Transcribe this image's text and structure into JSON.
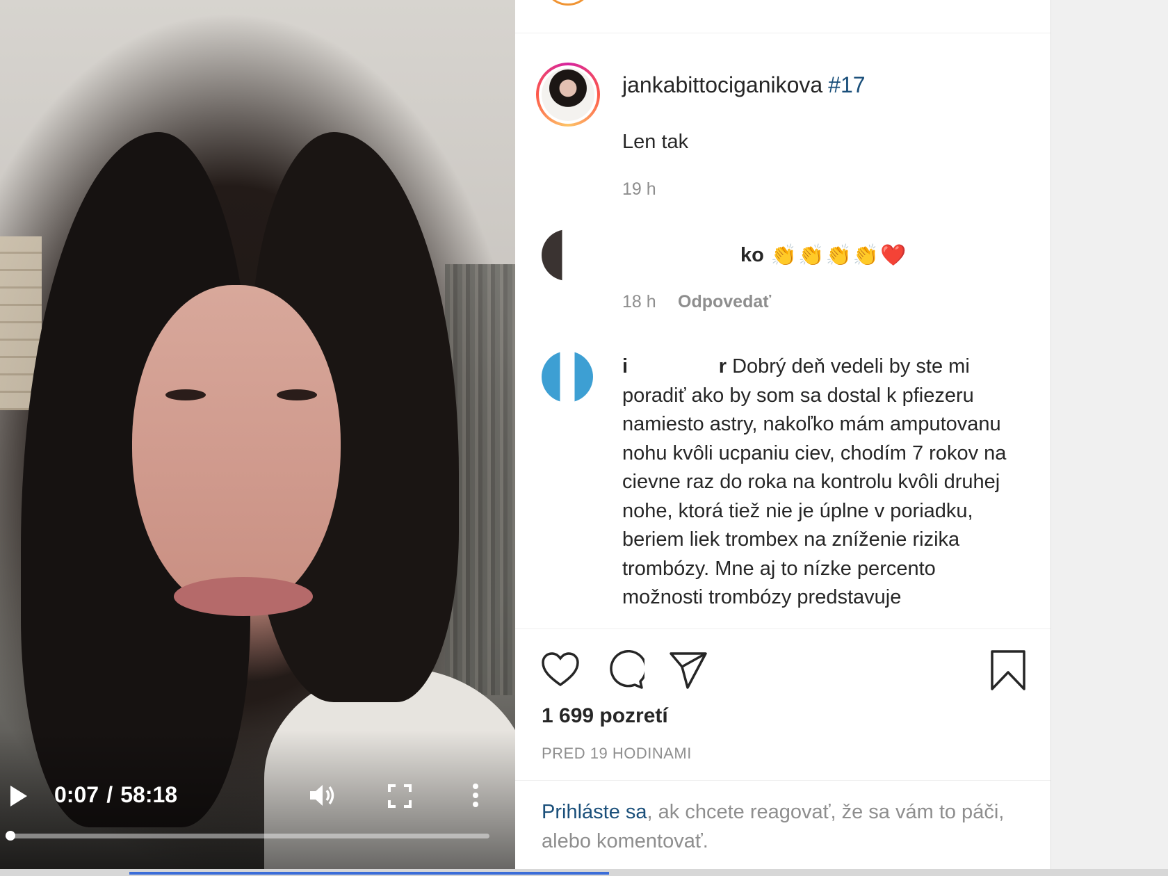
{
  "video": {
    "time_current": "0:07",
    "time_separator": "/",
    "time_total": "58:18",
    "progress_fraction": 0.002
  },
  "post": {
    "author": "jankabittociganikova",
    "hashtag": "#17",
    "caption": "Len tak",
    "time": "19 h"
  },
  "comments": [
    {
      "username_visible": "ko",
      "emojis": "👏👏👏👏❤️",
      "time": "18 h",
      "reply_label": "Odpovedať"
    },
    {
      "username_start": "i",
      "username_end": "r",
      "text": "Dobrý deň vedeli by ste mi poradiť ako by som sa dostal k pfiezeru namiesto astry, nakoľko mám amputovanu nohu kvôli ucpaniu ciev, chodím 7 rokov na cievne raz do roka na kontrolu kvôli druhej nohe, ktorá tiež nie je úplne v poriadku, beriem liek trombex na zníženie rizika trombózy. Mne aj to nízke percento možnosti trombózy predstavuje"
    }
  ],
  "actions": {
    "views": "1 699 pozretí",
    "date": "PRED 19 HODINAMI"
  },
  "login": {
    "link": "Prihláste sa",
    "rest": ", ak chcete reagovať, že sa vám to páči, alebo komentovať."
  },
  "icons": {
    "play": "play-icon",
    "volume": "volume-icon",
    "fullscreen": "fullscreen-icon",
    "more": "more-vertical-icon",
    "like": "heart-icon",
    "comment": "comment-icon",
    "share": "send-icon",
    "save": "bookmark-icon"
  }
}
